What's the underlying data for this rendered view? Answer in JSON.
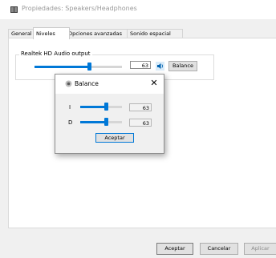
{
  "window": {
    "title": "Propiedades: Speakers/Headphones"
  },
  "tabs": [
    {
      "label": "General",
      "active": false
    },
    {
      "label": "Niveles",
      "active": true
    },
    {
      "label": "Opciones avanzadas",
      "active": false
    },
    {
      "label": "Sonido espacial",
      "active": false
    }
  ],
  "levels": {
    "group_label": "Realtek HD Audio output",
    "volume_value": "63",
    "volume_level": 0.63,
    "balance_button": "Balance",
    "speaker_icon": "speaker-icon"
  },
  "balance_dialog": {
    "title": "Balance",
    "left_label": "I",
    "left_value": "63",
    "left_level": 0.63,
    "right_label": "D",
    "right_value": "63",
    "right_level": 0.63,
    "ok_label": "Aceptar"
  },
  "footer": {
    "ok": "Aceptar",
    "cancel": "Cancelar",
    "apply": "Aplicar"
  },
  "colors": {
    "accent": "#0078d7",
    "dialog_bg": "#f0f0f0"
  }
}
